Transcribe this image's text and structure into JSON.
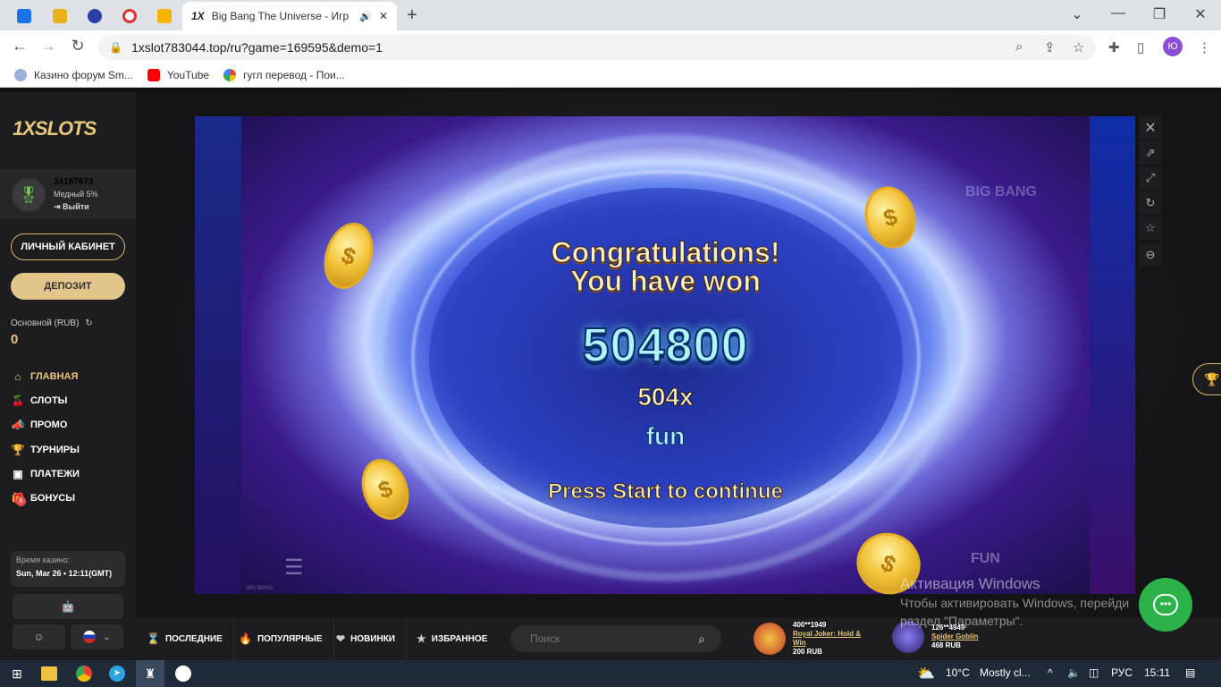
{
  "browser": {
    "active_tab_title": "Big Bang The Universe - Игр",
    "active_tab_favicon": "1X",
    "new_tab": "+",
    "url": "1xslot783044.top/ru?game=169595&demo=1",
    "profile_initial": "Ю",
    "bookmarks": [
      {
        "label": "Казино форум Sm...",
        "icon": "brain-icon"
      },
      {
        "label": "YouTube",
        "icon": "youtube-icon"
      },
      {
        "label": "гугл перевод - Пои...",
        "icon": "google-icon"
      }
    ]
  },
  "sidebar": {
    "logo": "1XSLOTS",
    "user_id": "34187673",
    "user_level": "Медный 5%",
    "logout": "Выйти",
    "cabinet_label": "ЛИЧНЫЙ КАБИНЕТ",
    "deposit_label": "ДЕПОЗИТ",
    "balance_label": "Основной (RUB)",
    "balance_value": "0",
    "nav": [
      {
        "label": "ГЛАВНАЯ",
        "icon": "home-icon"
      },
      {
        "label": "СЛОТЫ",
        "icon": "cherry-icon"
      },
      {
        "label": "ПРОМО",
        "icon": "megaphone-icon"
      },
      {
        "label": "ТУРНИРЫ",
        "icon": "trophy-icon"
      },
      {
        "label": "ПЛАТЕЖИ",
        "icon": "wallet-icon"
      },
      {
        "label": "БОНУСЫ",
        "icon": "gift-icon"
      }
    ],
    "bonus_count": "6",
    "time_label": "Время казино:",
    "time_value": "Sun, Mar 26 • 12:11(GMT)"
  },
  "game": {
    "congrats_line1": "Congratulations!",
    "congrats_line2": "You have won",
    "win_amount": "504800",
    "multiplier": "504x",
    "currency": "fun",
    "press_start": "Press Start to continue",
    "fun_label": "FUN",
    "logo_text": "BIG BANG",
    "bottom_small": "BIG BANG"
  },
  "bottom_bar": {
    "tabs": [
      {
        "label": "ПОСЛЕДНИЕ",
        "icon": "hourglass-icon"
      },
      {
        "label": "ПОПУЛЯРНЫЕ",
        "icon": "flame-icon"
      },
      {
        "label": "НОВИНКИ",
        "icon": "heart-icon"
      },
      {
        "label": "ИЗБРАННОЕ",
        "icon": "star-icon"
      }
    ],
    "search_placeholder": "Поиск",
    "winners": [
      {
        "user": "400**1949",
        "game": "Royal Joker: Hold & Win",
        "amount": "200 RUB"
      },
      {
        "user": "126**4949",
        "game": "Spider Goblin",
        "amount": "468 RUB"
      }
    ]
  },
  "windows_activation": {
    "line1": "Активация Windows",
    "line2": "Чтобы активировать Windows, перейди",
    "line3": "раздел \"Параметры\"."
  },
  "taskbar": {
    "weather": "10°C",
    "weather_desc": "Mostly cl...",
    "lang": "РУС",
    "clock": "15:11"
  },
  "colors": {
    "accent_gold": "#e7c77a",
    "sidebar_bg": "#1d1d1f",
    "chat_green": "#2bb34a"
  }
}
